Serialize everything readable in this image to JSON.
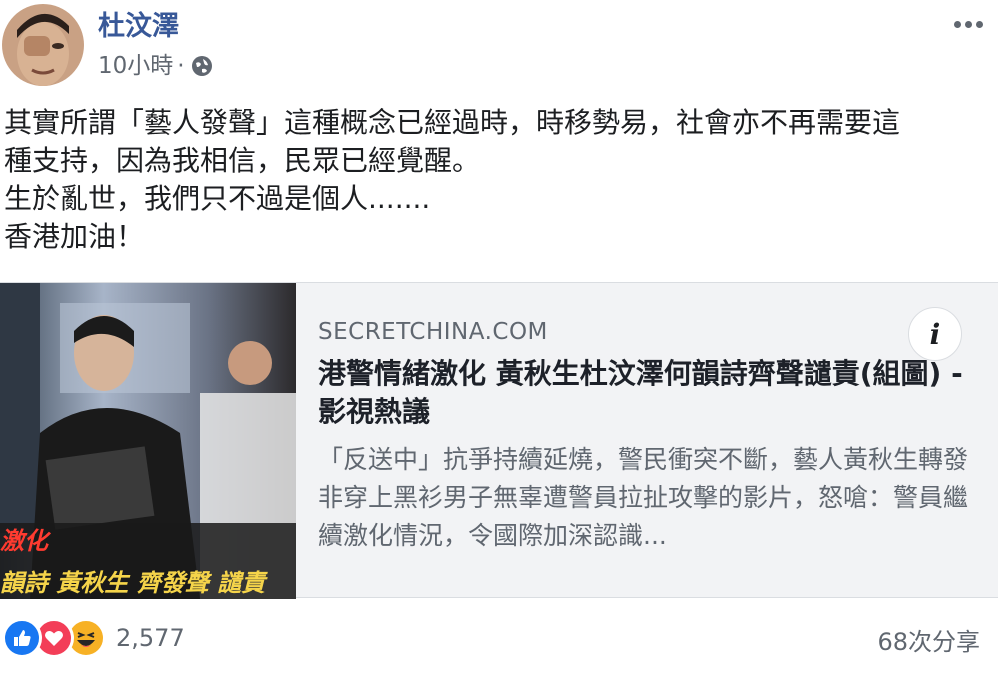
{
  "post": {
    "author": "杜汶澤",
    "timestamp": "10小時",
    "separator": "·",
    "privacy_icon": "globe-icon",
    "more_icon": "more-options-icon",
    "text_lines": [
      "其實所謂「藝人發聲」這種概念已經過時，時移勢易，社會亦不再需要這",
      "種支持，因為我相信，民眾已經覺醒。",
      "生於亂世，我們只不過是個人.......",
      "香港加油！"
    ]
  },
  "link_card": {
    "domain": "SECRETCHINA.COM",
    "headline": "港警情緒激化 黃秋生杜汶澤何韻詩齊聲譴責(組圖) - 影視熱議",
    "description": "「反送中」抗爭持續延燒，警民衝突不斷，藝人黃秋生轉發非穿上黑衫男子無辜遭警員拉扯攻擊的影片，怒嗆：警員繼續激化情況，令國際加深認識...",
    "info_label": "i",
    "thumbnail_caption_top": "激化",
    "thumbnail_caption": "韻詩 黃秋生 齊發聲 譴責"
  },
  "footer": {
    "reactions": [
      "like-icon",
      "love-icon",
      "haha-icon"
    ],
    "reaction_count": "2,577",
    "shares": "68次分享"
  },
  "colors": {
    "author": "#385898",
    "like": "#1877f2",
    "love": "#f33e58",
    "haha": "#f7b125",
    "card_bg": "#f2f3f5"
  }
}
